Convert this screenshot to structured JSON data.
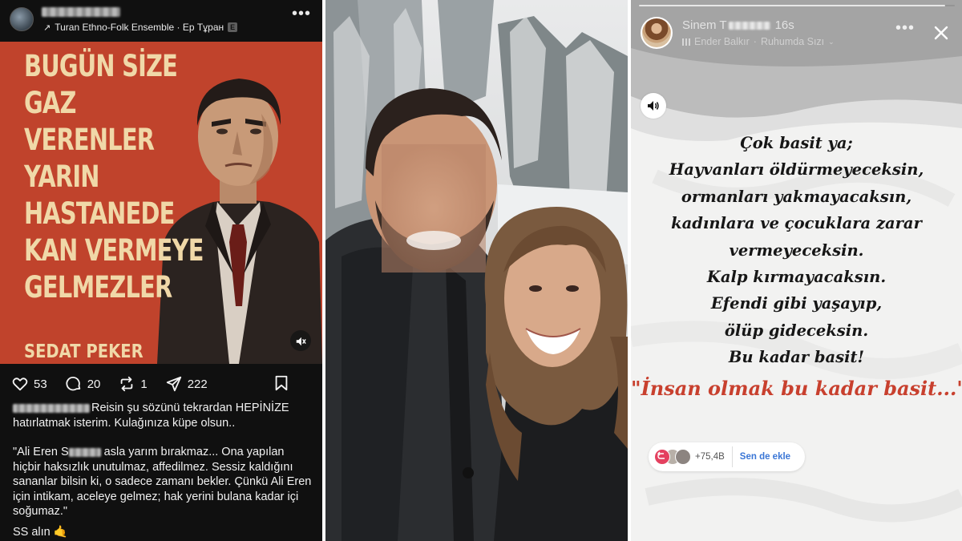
{
  "threads_post": {
    "music_track": "Turan Ethno-Folk Ensemble · Ep Тұран",
    "explicit_badge": "E",
    "more_label": "•••",
    "poster": {
      "lines": [
        "BUGÜN SİZE",
        "GAZ",
        "VERENLER",
        "YARIN",
        "HASTANEDE",
        "KAN VERMEYE",
        "GELMEZLER"
      ],
      "author": "SEDAT PEKER",
      "background_color": "#c0432c",
      "text_color": "#f0d8a8"
    },
    "mute_icon": "speaker-off-icon",
    "stats": {
      "likes": "53",
      "replies": "20",
      "reposts": "1",
      "shares": "222"
    },
    "caption": "Reisin şu sözünü tekrardan HEPİNİZE hatırlatmak isterim. Kulağınıza küpe olsun..",
    "quote_start": "\"Ali Eren S",
    "quote_rest": " asla yarım bırakmaz... Ona yapılan hiçbir haksızlık unutulmaz, affedilmez. Sessiz kaldığını sananlar bilsin ki, o sadece zamanı bekler. Çünkü Ali Eren için intikam, aceleye gelmez; hak yerini bulana kadar içi soğumaz.\"",
    "ss_label": "SS alın",
    "ss_emoji": "🤙"
  },
  "instagram_story": {
    "username_prefix": "Sinem T",
    "time_ago": "16s",
    "song_artist": "Ender Balkır",
    "song_title": "Ruhumda Sızı",
    "progress": 0.97,
    "lines": [
      "Çok basit ya;",
      "Hayvanları öldürmeyeceksin,",
      "ormanları yakmayacaksın,",
      "kadınlara ve çocuklara zarar",
      "vermeyeceksin.",
      "Kalp kırmayacaksın.",
      "Efendi gibi yaşayıp,",
      "ölüp gideceksin.",
      "Bu kadar basit!"
    ],
    "highlight": "\"İnsan olmak bu kadar basit...\"",
    "highlight_color": "#c8402e",
    "viewers_count": "+75,4B",
    "add_yours_label": "Sen de ekle",
    "accent_color": "#3a76d6"
  }
}
